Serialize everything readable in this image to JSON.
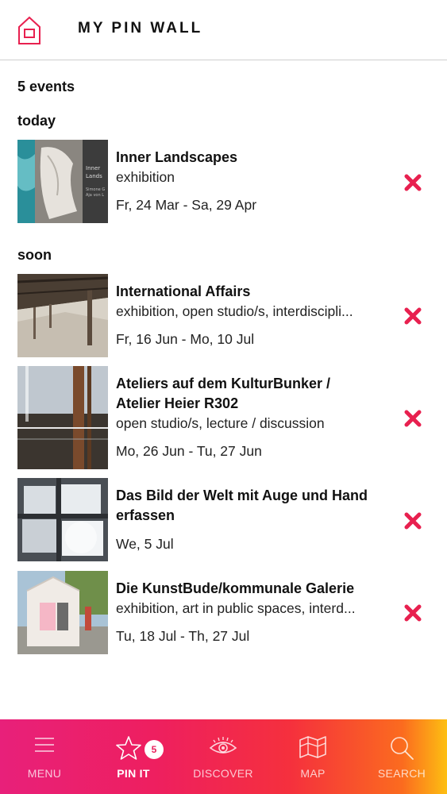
{
  "header": {
    "title": "MY PIN WALL",
    "home_icon": "home-icon"
  },
  "count_label": "5 events",
  "sections": [
    {
      "label": "today",
      "events": [
        {
          "title_lines": [
            "Inner Landscapes"
          ],
          "categories": "exhibition",
          "dates": "Fr, 24 Mar - Sa, 29 Apr",
          "thumb_text": [
            "Inner",
            "Lands",
            "Simone G",
            "Aja von L"
          ]
        }
      ]
    },
    {
      "label": "soon",
      "events": [
        {
          "title_lines": [
            "International Affairs"
          ],
          "categories": "exhibition, open studio/s, interdiscipli...",
          "dates": "Fr, 16 Jun - Mo, 10 Jul"
        },
        {
          "title_lines": [
            "Ateliers auf dem KulturBunker /",
            "Atelier Heier R302"
          ],
          "categories": "open studio/s, lecture / discussion",
          "dates": "Mo, 26 Jun - Tu, 27 Jun"
        },
        {
          "title_lines": [
            "Das Bild der Welt mit Auge und Hand",
            "erfassen"
          ],
          "categories": "",
          "dates": "We, 5 Jul"
        },
        {
          "title_lines": [
            "Die KunstBude/kommunale Galerie"
          ],
          "categories": "exhibition, art in public spaces, interd...",
          "dates": "Tu, 18 Jul - Th, 27 Jul"
        }
      ]
    }
  ],
  "tabbar": {
    "tabs": [
      {
        "label": "MENU",
        "icon": "menu-icon",
        "active": false
      },
      {
        "label": "PIN IT",
        "icon": "star-icon",
        "active": true,
        "badge": "5"
      },
      {
        "label": "DISCOVER",
        "icon": "eye-icon",
        "active": false
      },
      {
        "label": "MAP",
        "icon": "map-icon",
        "active": false
      },
      {
        "label": "SEARCH",
        "icon": "search-icon",
        "active": false
      }
    ]
  },
  "colors": {
    "accent": "#e8204f",
    "remove": "#e8204f",
    "gradient_start": "#e8207a",
    "gradient_end": "#fdbf12"
  }
}
